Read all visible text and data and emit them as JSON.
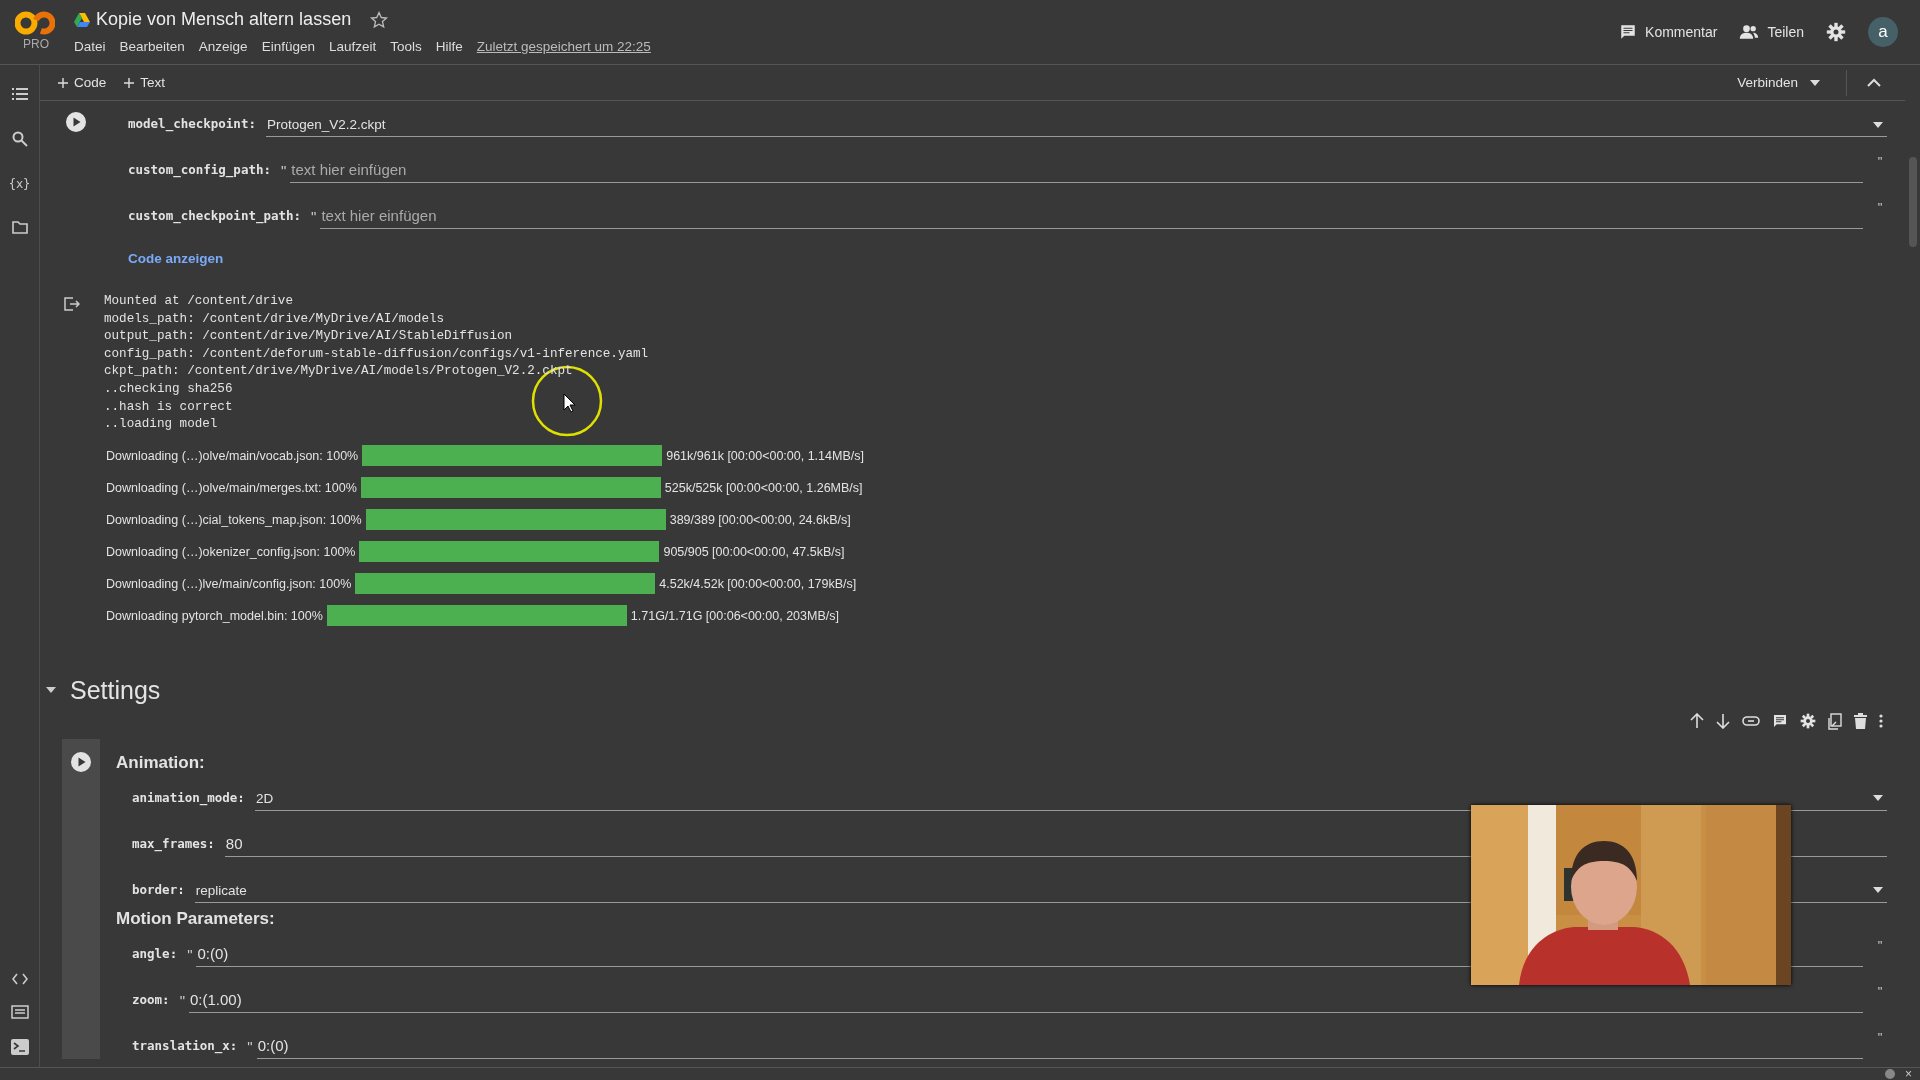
{
  "header": {
    "logo_sub": "PRO",
    "title": "Kopie von Mensch altern lassen",
    "starred": false,
    "menu": [
      "Datei",
      "Bearbeiten",
      "Anzeige",
      "Einfügen",
      "Laufzeit",
      "Tools",
      "Hilfe"
    ],
    "last_saved": "Zuletzt gespeichert um 22:25",
    "actions": [
      {
        "kind": "comment",
        "label": "Kommentar"
      },
      {
        "kind": "share",
        "label": "Teilen"
      }
    ],
    "avatar": "a"
  },
  "toolbar": {
    "add": [
      "Code",
      "Text"
    ],
    "connect": "Verbinden"
  },
  "sidebar": {
    "top": [
      {
        "kind": "toc"
      },
      {
        "kind": "search"
      },
      {
        "kind": "variables",
        "glyph": "{x}"
      },
      {
        "kind": "files"
      }
    ],
    "bottom": [
      {
        "kind": "code"
      },
      {
        "kind": "form"
      },
      {
        "kind": "terminal"
      }
    ]
  },
  "cell1": {
    "fields": [
      {
        "label": "model_checkpoint:",
        "kind": "dropdown",
        "value": "Protogen_V2.2.ckpt"
      },
      {
        "label": "custom_config_path:",
        "kind": "string",
        "open_quote": "\"",
        "close_quote": "\"",
        "placeholder": "text hier einfügen"
      },
      {
        "label": "custom_checkpoint_path:",
        "kind": "string",
        "open_quote": "\"",
        "close_quote": "\"",
        "placeholder": "text hier einfügen"
      }
    ],
    "show_code": "Code anzeigen",
    "output": [
      "Mounted at /content/drive",
      "models_path: /content/drive/MyDrive/AI/models",
      "output_path: /content/drive/MyDrive/AI/StableDiffusion",
      "config_path: /content/deforum-stable-diffusion/configs/v1-inference.yaml",
      "ckpt_path: /content/drive/MyDrive/AI/models/Protogen_V2.2.ckpt",
      "..checking sha256",
      "..hash is correct",
      "..loading model"
    ],
    "progress": [
      {
        "label": "Downloading (…)olve/main/vocab.json: 100%",
        "level": 1,
        "stats": "961k/961k [00:00<00:00, 1.14MB/s]"
      },
      {
        "label": "Downloading (…)olve/main/merges.txt: 100%",
        "level": 1,
        "stats": "525k/525k [00:00<00:00, 1.26MB/s]"
      },
      {
        "label": "Downloading (…)cial_tokens_map.json: 100%",
        "level": 1,
        "stats": "389/389 [00:00<00:00, 24.6kB/s]"
      },
      {
        "label": "Downloading (…)okenizer_config.json: 100%",
        "level": 1,
        "stats": "905/905 [00:00<00:00, 47.5kB/s]"
      },
      {
        "label": "Downloading (…)lve/main/config.json: 100%",
        "level": 1,
        "stats": "4.52k/4.52k [00:00<00:00, 179kB/s]"
      },
      {
        "label": "Downloading pytorch_model.bin: 100%",
        "level": 1,
        "stats": "1.71G/1.71G [00:06<00:00, 203MB/s]"
      }
    ]
  },
  "section": {
    "title": "Settings",
    "expanded": true
  },
  "cell2": {
    "groups": [
      {
        "heading": "Animation:",
        "fields": [
          {
            "label": "animation_mode:",
            "kind": "dropdown",
            "value": "2D"
          },
          {
            "label": "max_frames:",
            "kind": "number",
            "value": "80"
          },
          {
            "label": "border:",
            "kind": "dropdown",
            "value": "replicate"
          }
        ]
      },
      {
        "heading": "Motion Parameters:",
        "fields": [
          {
            "label": "angle:",
            "kind": "string",
            "open_quote": "\"",
            "close_quote": "\"",
            "value": "0:(0)"
          },
          {
            "label": "zoom:",
            "kind": "string",
            "open_quote": "\"",
            "close_quote": "\"",
            "value": "0:(1.00)"
          },
          {
            "label": "translation_x:",
            "kind": "string",
            "open_quote": "\"",
            "close_quote": "\"",
            "value": "0:(0)"
          }
        ]
      }
    ]
  },
  "status_bar": {
    "close": "×"
  }
}
